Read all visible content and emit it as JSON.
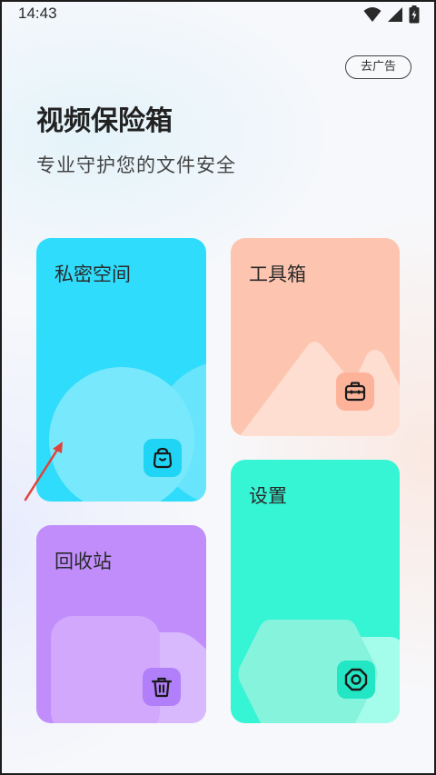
{
  "status_bar": {
    "time": "14:43"
  },
  "header": {
    "remove_ads_label": "去广告",
    "title": "视频保险箱",
    "subtitle": "专业守护您的文件安全"
  },
  "cards": {
    "private": {
      "label": "私密空间",
      "icon": "bag-icon",
      "color": "#2fdcfb"
    },
    "tools": {
      "label": "工具箱",
      "icon": "toolbox-icon",
      "color": "#fdc5b0"
    },
    "recycle": {
      "label": "回收站",
      "icon": "trash-icon",
      "color": "#c08dfb"
    },
    "settings": {
      "label": "设置",
      "icon": "gear-icon",
      "color": "#36f5d5"
    }
  }
}
